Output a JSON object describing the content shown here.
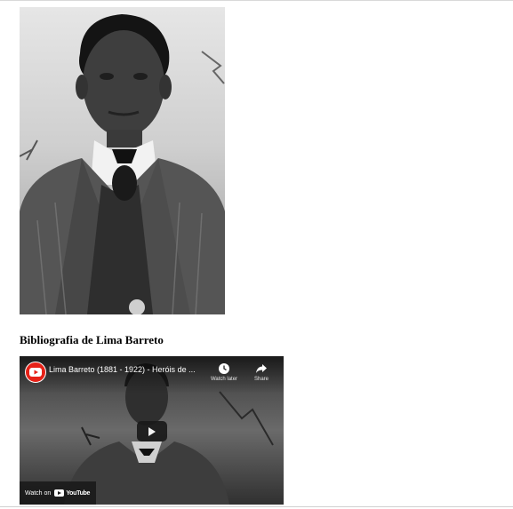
{
  "portrait": {
    "alt": "Lima Barreto"
  },
  "section_heading": "Bibliografia de Lima Barreto",
  "video": {
    "title": "Lima Barreto (1881 - 1922) - Heróis de ...",
    "watch_later_label": "Watch later",
    "share_label": "Share",
    "watch_on_label": "Watch on",
    "platform_label": "YouTube"
  },
  "colors": {
    "youtube_red": "#e62117",
    "overlay": "#141414"
  }
}
